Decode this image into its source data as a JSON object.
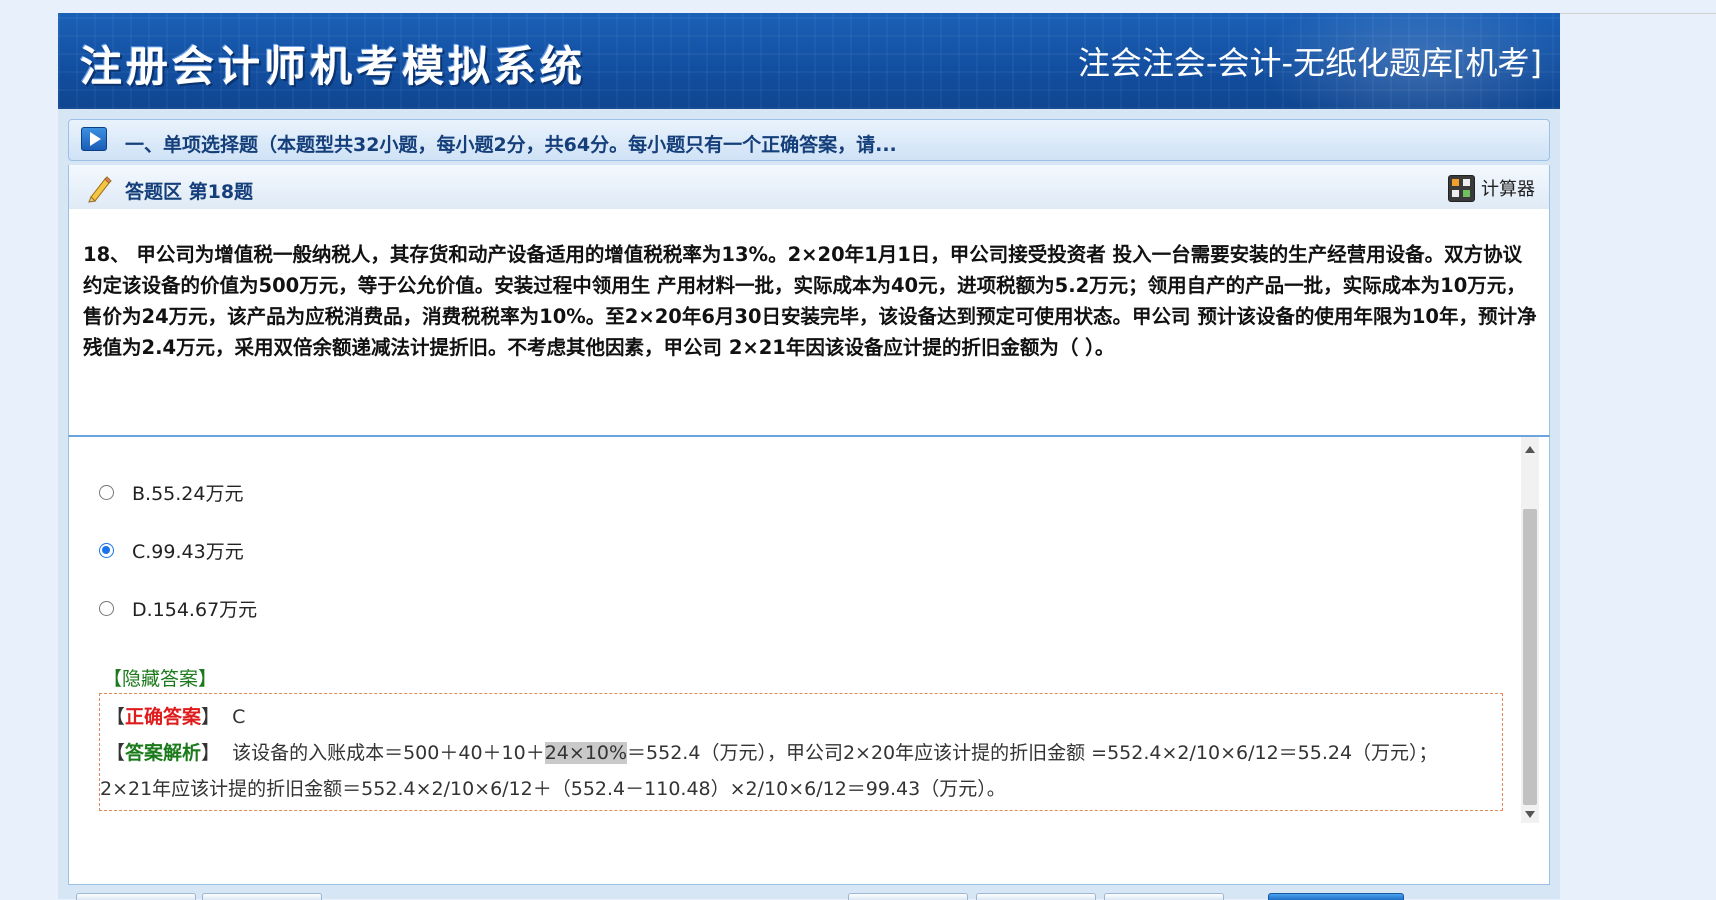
{
  "header": {
    "system_title": "注册会计师机考模拟系统",
    "bank_title": "注会注会-会计-无纸化题库[机考]"
  },
  "section": {
    "icon": "play-icon",
    "text": "一、单项选择题（本题型共32小题，每小题2分，共64分。每小题只有一个正确答案，请..."
  },
  "answer_area": {
    "icon": "pencil-icon",
    "title": "答题区 第18题",
    "calculator_label": "计算器",
    "calculator_icon": "calculator-icon"
  },
  "question": {
    "text": "18、 甲公司为增值税一般纳税人，其存货和动产设备适用的增值税税率为13%。2×20年1月1日，甲公司接受投资者 投入一台需要安装的生产经营用设备。双方协议约定该设备的价值为500万元，等于公允价值。安装过程中领用生 产用材料一批，实际成本为40元，进项税额为5.2万元；领用自产的产品一批，实际成本为10万元，售价为24万元，该产品为应税消费品，消费税税率为10%。至2×20年6月30日安装完毕，该设备达到预定可使用状态。甲公司 预计该设备的使用年限为10年，预计净残值为2.4万元，采用双倍余额递减法计提折旧。不考虑其他因素，甲公司 2×21年因该设备应计提的折旧金额为（ ）。"
  },
  "options": [
    {
      "label": "B.55.24万元",
      "checked": false
    },
    {
      "label": "C.99.43万元",
      "checked": true
    },
    {
      "label": "D.154.67万元",
      "checked": false
    }
  ],
  "hidden_answer_label": "【隐藏答案】",
  "answer": {
    "correct_prefix_open": "【",
    "correct_label": "正确答案",
    "correct_prefix_close": "】",
    "correct_value": "C",
    "analysis_open": "【",
    "analysis_label": "答案解析",
    "analysis_close": "】",
    "analysis_part1": "该设备的入账成本＝500＋40＋10＋",
    "analysis_highlight": "24×10%",
    "analysis_part2": "＝552.4（万元），甲公司2×20年应该计提的折旧金额 =552.4×2/10×6/12＝55.24（万元）；",
    "analysis_line2": "2×21年应该计提的折旧金额＝552.4×2/10×6/12＋（552.4－110.48）×2/10×6/12＝99.43（万元）。"
  },
  "colors": {
    "banner": "#124e9f",
    "section_text": "#153f7a",
    "correct_label": "#e01b1b",
    "analysis_label": "#1b7a1b",
    "radio_checked": "#1a73e8"
  }
}
